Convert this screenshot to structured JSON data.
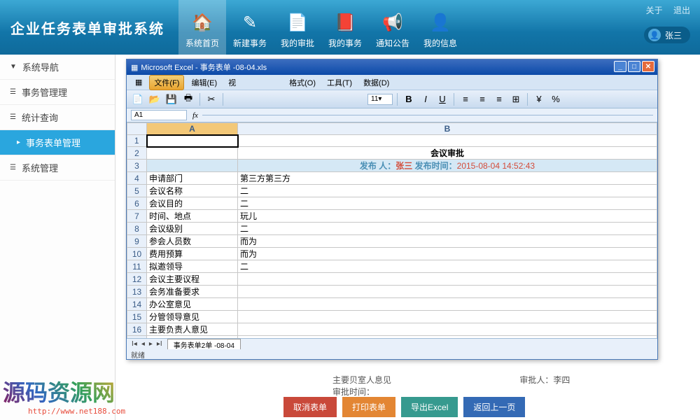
{
  "header": {
    "sysTitle": "企业任务表单审批系统",
    "nav": [
      {
        "label": "系统首页",
        "icon": "🏠"
      },
      {
        "label": "新建事务",
        "icon": "✎"
      },
      {
        "label": "我的审批",
        "icon": "📄"
      },
      {
        "label": "我的事务",
        "icon": "📕"
      },
      {
        "label": "通知公告",
        "icon": "📢"
      },
      {
        "label": "我的信息",
        "icon": "👤"
      }
    ],
    "links": {
      "about": "关于",
      "logout": "退出"
    },
    "user": "张三"
  },
  "sidebar": {
    "items": [
      {
        "label": "系统导航"
      },
      {
        "label": "事务管理理"
      },
      {
        "label": "统计查询"
      },
      {
        "label": "事务表单管理",
        "sel": true,
        "indent": true
      },
      {
        "label": "系统管理"
      }
    ]
  },
  "excel": {
    "title": "Microsoft Excel - 事务表单  -08-04.xls",
    "menu": {
      "file": "文件(F)",
      "edit": "编辑(E)",
      "view": "视",
      "format": "格式(O)",
      "tools": "工具(T)",
      "data": "数据(D)"
    },
    "toolbar": {
      "fontSize": "11",
      "cellRef": "A1"
    },
    "sheetTab": "事务表单2单 -08-04",
    "status": "就绪",
    "cells": {
      "c2b": "会议审批",
      "c3_publisher_label": "发布 人：",
      "c3_publisher": "张三",
      "c3_time_label": "发布时间：",
      "c3_time": "2015-08-04 14:52:43",
      "r4a": "申请部门",
      "r4b": "第三方第三方",
      "r5a": "会议名称",
      "r5b": "二",
      "r6a": "会议目的",
      "r6b": "二",
      "r7a": "时间、地点",
      "r7b": "玩儿",
      "r8a": "会议级别",
      "r8b": "二",
      "r9a": "参会人员数",
      "r9b": "而为",
      "r10a": "费用预算",
      "r10b": "而为",
      "r11a": "拟邀领导",
      "r11b": "二",
      "r12a": "会议主要议程",
      "r13a": "会务准备要求",
      "r14a": "办公室意见",
      "r15a": "分管领导意见",
      "r16a": "主要负责人意见"
    }
  },
  "bottomRow": {
    "c1": "主要贝室人息见",
    "c2": "审批人：李四",
    "c3": "审批时间："
  },
  "actions": {
    "cancel": "取消表单",
    "print": "打印表单",
    "export": "导出Excel",
    "back": "返回上一页"
  },
  "watermark": {
    "text": "源码资源网",
    "url": "http://www.net188.com"
  }
}
